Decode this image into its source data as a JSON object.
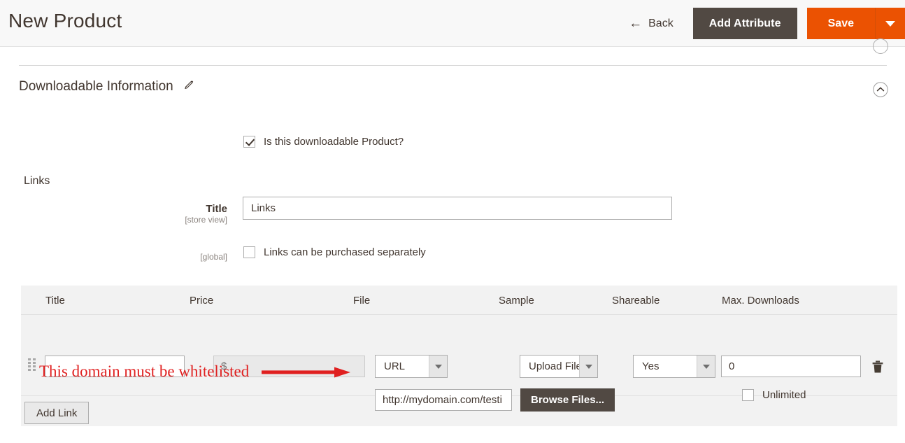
{
  "header": {
    "title": "New Product",
    "back_label": "Back",
    "add_attribute_label": "Add Attribute",
    "save_label": "Save",
    "save_caret_icon": "caret-down-icon",
    "back_icon": "arrow-left-icon",
    "accent_color": "#eb5202",
    "dark_color": "#514943"
  },
  "section": {
    "title": "Downloadable Information",
    "edit_icon": "pencil-icon",
    "collapse_icon": "chevron-up-circle-icon"
  },
  "downloadable": {
    "is_downloadable_label": "Is this downloadable Product?",
    "is_downloadable_checked": true
  },
  "links": {
    "heading": "Links",
    "title_field": {
      "label": "Title",
      "scope": "[store view]",
      "value": "Links"
    },
    "purchase_separately": {
      "scope": "[global]",
      "label": "Links can be purchased separately",
      "checked": false
    },
    "table": {
      "columns": [
        "Title",
        "Price",
        "File",
        "Sample",
        "Shareable",
        "Max. Downloads"
      ],
      "row": {
        "drag_icon": "drag-handle-icon",
        "title_value": "",
        "price_placeholder": "$",
        "price_value": "",
        "file_select": "URL",
        "sample_select": "Upload File",
        "shareable_select": "Yes",
        "max_downloads_value": "0",
        "delete_icon": "trash-icon",
        "url_value": "http://mydomain.com/testi",
        "browse_files_label": "Browse Files...",
        "unlimited_label": "Unlimited",
        "unlimited_checked": false
      },
      "add_link_label": "Add Link"
    }
  },
  "annotation": {
    "text": "This domain must be whitelisted",
    "color": "#e02020",
    "arrow_icon": "arrow-right-icon"
  }
}
